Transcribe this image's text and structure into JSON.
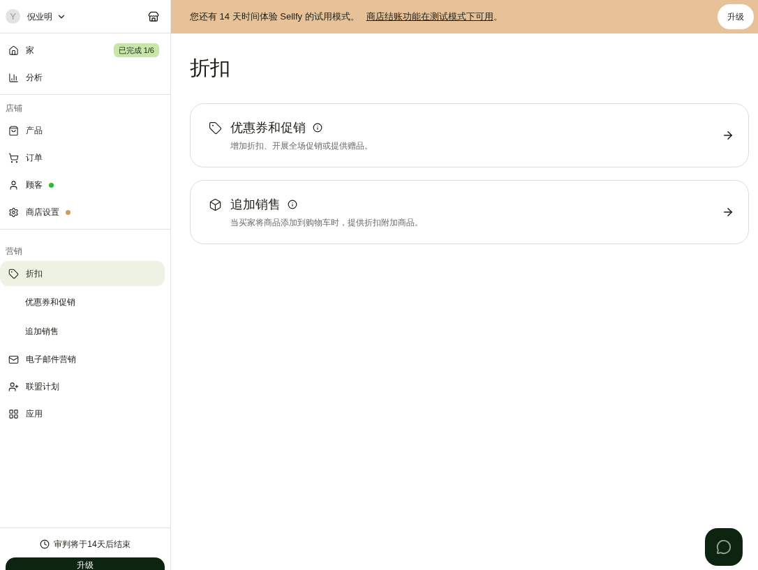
{
  "account": {
    "avatar_letter": "Y",
    "name": "倪业明"
  },
  "nav_main": [
    {
      "label": "家",
      "badge": "已完成 1/6",
      "selected": false
    },
    {
      "label": "分析",
      "selected": false
    }
  ],
  "sections": [
    {
      "heading": "店铺",
      "items": [
        {
          "label": "产品",
          "selected": false
        },
        {
          "label": "订单",
          "selected": false
        },
        {
          "label": "顾客",
          "selected": false,
          "color": "#2fb82f"
        },
        {
          "label": "商店设置",
          "selected": false,
          "color": "#d49a5c"
        }
      ]
    },
    {
      "heading": "营销",
      "items": [
        {
          "label": "折扣",
          "selected": true,
          "children": [
            {
              "label": "优惠券和促销",
              "selected": false
            },
            {
              "label": "追加销售",
              "selected": false
            }
          ]
        },
        {
          "label": "电子邮件营销",
          "selected": false
        },
        {
          "label": "联盟计划",
          "selected": false
        },
        {
          "label": "应用",
          "selected": false
        }
      ]
    }
  ],
  "trial_note": "审判将于14天后结束",
  "sidebar_upgrade": "升级",
  "banner": {
    "text": "您还有 14 天时间体验 Sellfy 的试用模式。",
    "link": "商店结账功能在测试模式下可用",
    "end": "。",
    "button": "升级"
  },
  "page_title": "折扣",
  "cards": [
    {
      "title": "优惠券和促销",
      "description": "增加折扣、开展全场促销或提供赠品。"
    },
    {
      "title": "追加销售",
      "description": "当买家将商品添加到购物车时，提供折扣附加商品。"
    }
  ]
}
